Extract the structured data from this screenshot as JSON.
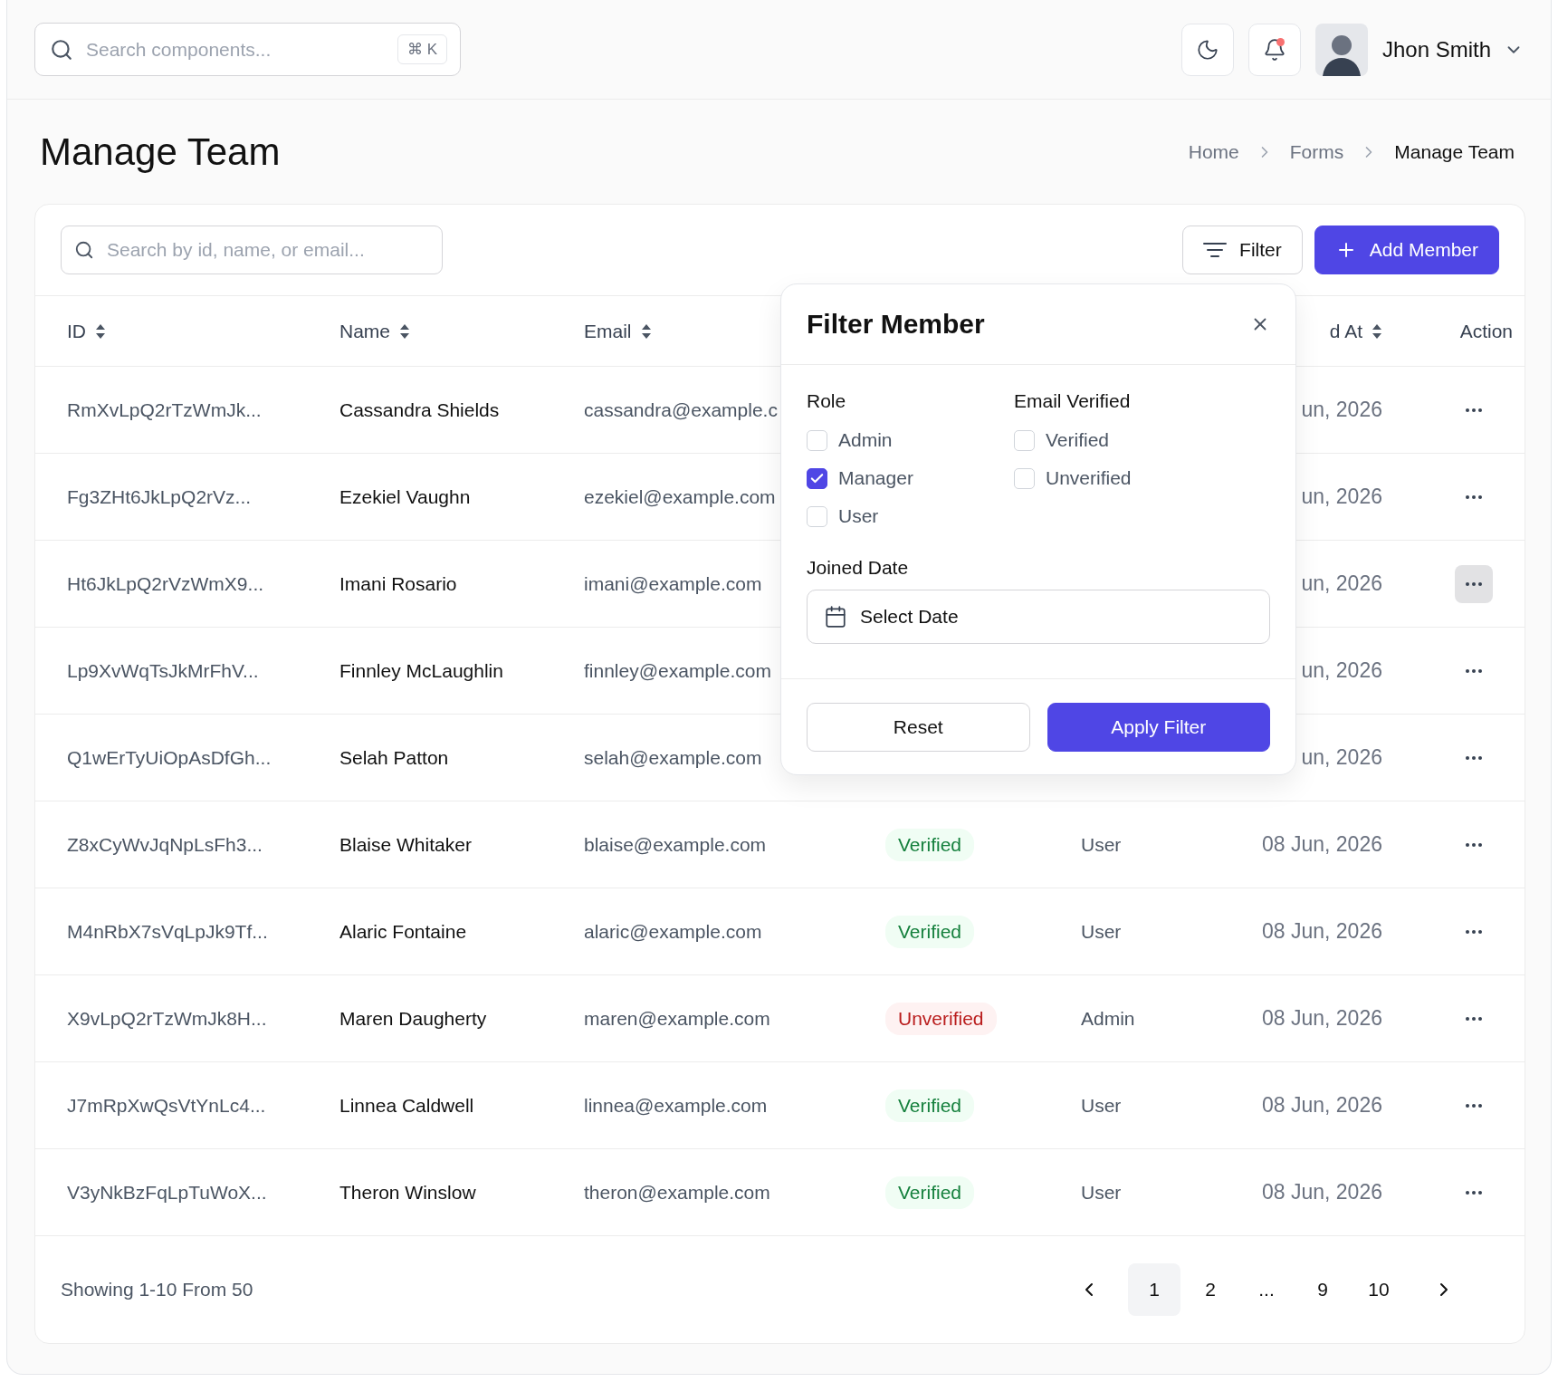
{
  "topbar": {
    "search": {
      "placeholder": "Search components...",
      "shortcut": "⌘ K"
    },
    "notifications": {
      "unread": true
    },
    "user": {
      "name": "Jhon Smith"
    }
  },
  "page": {
    "title": "Manage Team",
    "breadcrumbs": [
      {
        "label": "Home",
        "current": false
      },
      {
        "label": "Forms",
        "current": false
      },
      {
        "label": "Manage Team",
        "current": true
      }
    ]
  },
  "toolbar": {
    "search": {
      "placeholder": "Search by id, name, or email..."
    },
    "filter_button": "Filter",
    "add_button": "Add Member"
  },
  "table": {
    "columns": [
      {
        "label": "ID",
        "sortable": true
      },
      {
        "label": "Name",
        "sortable": true
      },
      {
        "label": "Email",
        "sortable": true
      },
      {
        "label": "d At",
        "sortable": true
      },
      {
        "label": "Action",
        "sortable": false
      }
    ],
    "rows": [
      {
        "id": "RmXvLpQ2rTzWmJk...",
        "name": "Cassandra Shields",
        "email": "cassandra@example.c",
        "joined": "un, 2026",
        "highlighted": false
      },
      {
        "id": "Fg3ZHt6JkLpQ2rVz...",
        "name": "Ezekiel Vaughn",
        "email": "ezekiel@example.com",
        "joined": "un, 2026",
        "highlighted": false
      },
      {
        "id": "Ht6JkLpQ2rVzWmX9...",
        "name": "Imani Rosario",
        "email": "imani@example.com",
        "joined": "un, 2026",
        "highlighted": true
      },
      {
        "id": "Lp9XvWqTsJkMrFhV...",
        "name": "Finnley McLaughlin",
        "email": "finnley@example.com",
        "joined": "un, 2026",
        "highlighted": false
      },
      {
        "id": "Q1wErTyUiOpAsDfGh...",
        "name": "Selah Patton",
        "email": "selah@example.com",
        "joined": "un, 2026",
        "highlighted": false
      },
      {
        "id": "Z8xCyWvJqNpLsFh3...",
        "name": "Blaise Whitaker",
        "email": "blaise@example.com",
        "status": {
          "label": "Verified",
          "verified": true
        },
        "role": "User",
        "joined": "08 Jun, 2026",
        "highlighted": false
      },
      {
        "id": "M4nRbX7sVqLpJk9Tf...",
        "name": "Alaric Fontaine",
        "email": "alaric@example.com",
        "status": {
          "label": "Verified",
          "verified": true
        },
        "role": "User",
        "joined": "08 Jun, 2026",
        "highlighted": false
      },
      {
        "id": "X9vLpQ2rTzWmJk8H...",
        "name": "Maren Daugherty",
        "email": "maren@example.com",
        "status": {
          "label": "Unverified",
          "verified": false
        },
        "role": "Admin",
        "joined": "08 Jun, 2026",
        "highlighted": false
      },
      {
        "id": "J7mRpXwQsVtYnLc4...",
        "name": "Linnea Caldwell",
        "email": "linnea@example.com",
        "status": {
          "label": "Verified",
          "verified": true
        },
        "role": "User",
        "joined": "08 Jun, 2026",
        "highlighted": false
      },
      {
        "id": "V3yNkBzFqLpTuWoX...",
        "name": "Theron Winslow",
        "email": "theron@example.com",
        "status": {
          "label": "Verified",
          "verified": true
        },
        "role": "User",
        "joined": "08 Jun, 2026",
        "highlighted": false
      }
    ]
  },
  "footer": {
    "summary": "Showing 1-10 From 50",
    "pages": [
      {
        "label": "1",
        "selected": true
      },
      {
        "label": "2",
        "selected": false
      },
      {
        "label": "...",
        "selected": false
      },
      {
        "label": "9",
        "selected": false
      },
      {
        "label": "10",
        "selected": false
      }
    ]
  },
  "filter_popup": {
    "title": "Filter Member",
    "groups": [
      {
        "label": "Role",
        "options": [
          {
            "label": "Admin",
            "checked": false
          },
          {
            "label": "Manager",
            "checked": true
          },
          {
            "label": "User",
            "checked": false
          }
        ]
      },
      {
        "label": "Email Verified",
        "options": [
          {
            "label": "Verified",
            "checked": false
          },
          {
            "label": "Unverified",
            "checked": false
          }
        ]
      }
    ],
    "date_label": "Joined Date",
    "date_placeholder": "Select Date",
    "reset_button": "Reset",
    "apply_button": "Apply Filter"
  }
}
